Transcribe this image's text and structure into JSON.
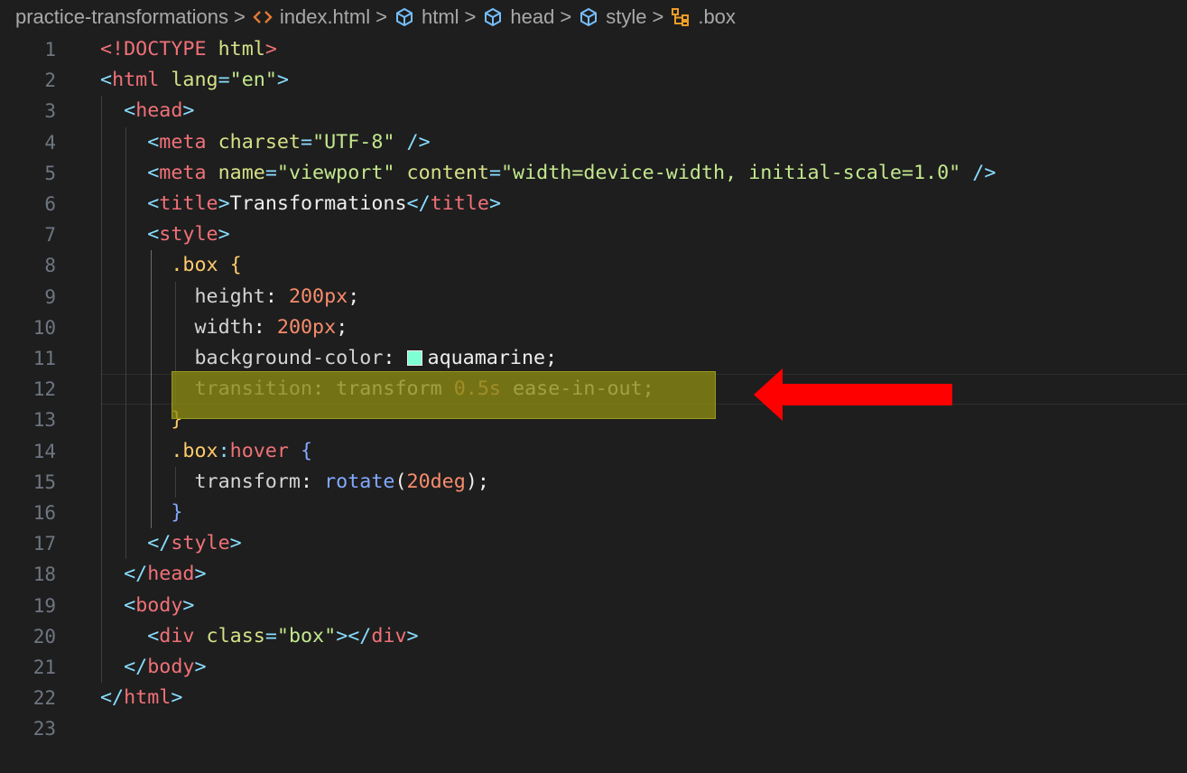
{
  "breadcrumb": {
    "items": [
      {
        "label": "practice-transformations",
        "icon": ""
      },
      {
        "label": "index.html",
        "icon": "html-file-icon"
      },
      {
        "label": "html",
        "icon": "element-icon"
      },
      {
        "label": "head",
        "icon": "element-icon"
      },
      {
        "label": "style",
        "icon": "element-icon"
      },
      {
        "label": ".box",
        "icon": "css-selector-icon"
      }
    ],
    "separator": ">"
  },
  "editor": {
    "current_line": 12,
    "line_numbers": [
      "1",
      "2",
      "3",
      "4",
      "5",
      "6",
      "7",
      "8",
      "9",
      "10",
      "11",
      "12",
      "13",
      "14",
      "15",
      "16",
      "17",
      "18",
      "19",
      "20",
      "21",
      "22",
      "23"
    ],
    "lines": [
      [
        {
          "t": "tag",
          "v": "<!DOCTYPE "
        },
        {
          "t": "attr",
          "v": "html"
        },
        {
          "t": "tag",
          "v": ">"
        }
      ],
      [
        {
          "t": "punct",
          "v": "<"
        },
        {
          "t": "tag",
          "v": "html"
        },
        {
          "t": "txt",
          "v": " "
        },
        {
          "t": "attr",
          "v": "lang"
        },
        {
          "t": "punct",
          "v": "="
        },
        {
          "t": "str",
          "v": "\"en\""
        },
        {
          "t": "punct",
          "v": ">"
        }
      ],
      [
        {
          "t": "txt",
          "v": "  "
        },
        {
          "t": "punct",
          "v": "<"
        },
        {
          "t": "tag",
          "v": "head"
        },
        {
          "t": "punct",
          "v": ">"
        }
      ],
      [
        {
          "t": "txt",
          "v": "    "
        },
        {
          "t": "punct",
          "v": "<"
        },
        {
          "t": "tag",
          "v": "meta"
        },
        {
          "t": "txt",
          "v": " "
        },
        {
          "t": "attr",
          "v": "charset"
        },
        {
          "t": "punct",
          "v": "="
        },
        {
          "t": "str",
          "v": "\"UTF-8\""
        },
        {
          "t": "txt",
          "v": " "
        },
        {
          "t": "punct",
          "v": "/>"
        }
      ],
      [
        {
          "t": "txt",
          "v": "    "
        },
        {
          "t": "punct",
          "v": "<"
        },
        {
          "t": "tag",
          "v": "meta"
        },
        {
          "t": "txt",
          "v": " "
        },
        {
          "t": "attr",
          "v": "name"
        },
        {
          "t": "punct",
          "v": "="
        },
        {
          "t": "str",
          "v": "\"viewport\""
        },
        {
          "t": "txt",
          "v": " "
        },
        {
          "t": "attr",
          "v": "content"
        },
        {
          "t": "punct",
          "v": "="
        },
        {
          "t": "str",
          "v": "\"width=device-width, initial-scale=1.0\""
        },
        {
          "t": "txt",
          "v": " "
        },
        {
          "t": "punct",
          "v": "/>"
        }
      ],
      [
        {
          "t": "txt",
          "v": "    "
        },
        {
          "t": "punct",
          "v": "<"
        },
        {
          "t": "tag",
          "v": "title"
        },
        {
          "t": "punct",
          "v": ">"
        },
        {
          "t": "txt",
          "v": "Transformations"
        },
        {
          "t": "punct",
          "v": "</"
        },
        {
          "t": "tag",
          "v": "title"
        },
        {
          "t": "punct",
          "v": ">"
        }
      ],
      [
        {
          "t": "txt",
          "v": "    "
        },
        {
          "t": "punct",
          "v": "<"
        },
        {
          "t": "tag",
          "v": "style"
        },
        {
          "t": "punct",
          "v": ">"
        }
      ],
      [
        {
          "t": "txt",
          "v": "      "
        },
        {
          "t": "sel",
          "v": ".box"
        },
        {
          "t": "txt",
          "v": " "
        },
        {
          "t": "sel",
          "v": "{"
        }
      ],
      [
        {
          "t": "txt",
          "v": "        "
        },
        {
          "t": "prop",
          "v": "height"
        },
        {
          "t": "txt",
          "v": ": "
        },
        {
          "t": "num",
          "v": "200px"
        },
        {
          "t": "txt",
          "v": ";"
        }
      ],
      [
        {
          "t": "txt",
          "v": "        "
        },
        {
          "t": "prop",
          "v": "width"
        },
        {
          "t": "txt",
          "v": ": "
        },
        {
          "t": "num",
          "v": "200px"
        },
        {
          "t": "txt",
          "v": ";"
        }
      ],
      [
        {
          "t": "txt",
          "v": "        "
        },
        {
          "t": "prop",
          "v": "background-color"
        },
        {
          "t": "txt",
          "v": ": "
        },
        {
          "t": "swatch",
          "v": ""
        },
        {
          "t": "txt",
          "v": "aquamarine;"
        }
      ],
      [
        {
          "t": "txt",
          "v": "        "
        },
        {
          "t": "prop",
          "v": "transition"
        },
        {
          "t": "txt",
          "v": ": "
        },
        {
          "t": "txt",
          "v": "transform "
        },
        {
          "t": "num",
          "v": "0.5s"
        },
        {
          "t": "txt",
          "v": " ease-in-out;"
        }
      ],
      [
        {
          "t": "txt",
          "v": "      "
        },
        {
          "t": "sel",
          "v": "}"
        }
      ],
      [
        {
          "t": "txt",
          "v": "      "
        },
        {
          "t": "sel",
          "v": ".box"
        },
        {
          "t": "punct",
          "v": ":"
        },
        {
          "t": "tag",
          "v": "hover"
        },
        {
          "t": "txt",
          "v": " "
        },
        {
          "t": "fn",
          "v": "{"
        }
      ],
      [
        {
          "t": "txt",
          "v": "        "
        },
        {
          "t": "prop",
          "v": "transform"
        },
        {
          "t": "txt",
          "v": ": "
        },
        {
          "t": "fn",
          "v": "rotate"
        },
        {
          "t": "txt",
          "v": "("
        },
        {
          "t": "num",
          "v": "20deg"
        },
        {
          "t": "txt",
          "v": ");"
        }
      ],
      [
        {
          "t": "txt",
          "v": "      "
        },
        {
          "t": "fn",
          "v": "}"
        }
      ],
      [
        {
          "t": "txt",
          "v": "    "
        },
        {
          "t": "punct",
          "v": "</"
        },
        {
          "t": "tag",
          "v": "style"
        },
        {
          "t": "punct",
          "v": ">"
        }
      ],
      [
        {
          "t": "txt",
          "v": "  "
        },
        {
          "t": "punct",
          "v": "</"
        },
        {
          "t": "tag",
          "v": "head"
        },
        {
          "t": "punct",
          "v": ">"
        }
      ],
      [
        {
          "t": "txt",
          "v": "  "
        },
        {
          "t": "punct",
          "v": "<"
        },
        {
          "t": "tag",
          "v": "body"
        },
        {
          "t": "punct",
          "v": ">"
        }
      ],
      [
        {
          "t": "txt",
          "v": "    "
        },
        {
          "t": "punct",
          "v": "<"
        },
        {
          "t": "tag",
          "v": "div"
        },
        {
          "t": "txt",
          "v": " "
        },
        {
          "t": "attr",
          "v": "class"
        },
        {
          "t": "punct",
          "v": "="
        },
        {
          "t": "str",
          "v": "\"box\""
        },
        {
          "t": "punct",
          "v": "></"
        },
        {
          "t": "tag",
          "v": "div"
        },
        {
          "t": "punct",
          "v": ">"
        }
      ],
      [
        {
          "t": "txt",
          "v": "  "
        },
        {
          "t": "punct",
          "v": "</"
        },
        {
          "t": "tag",
          "v": "body"
        },
        {
          "t": "punct",
          "v": ">"
        }
      ],
      [
        {
          "t": "punct",
          "v": "</"
        },
        {
          "t": "tag",
          "v": "html"
        },
        {
          "t": "punct",
          "v": ">"
        }
      ],
      []
    ]
  },
  "annotations": {
    "highlight_color": "#8c8c14",
    "arrow_color": "#ff0000"
  },
  "colors": {
    "background": "#1e1e1e",
    "swatch": "#7fffd4"
  }
}
